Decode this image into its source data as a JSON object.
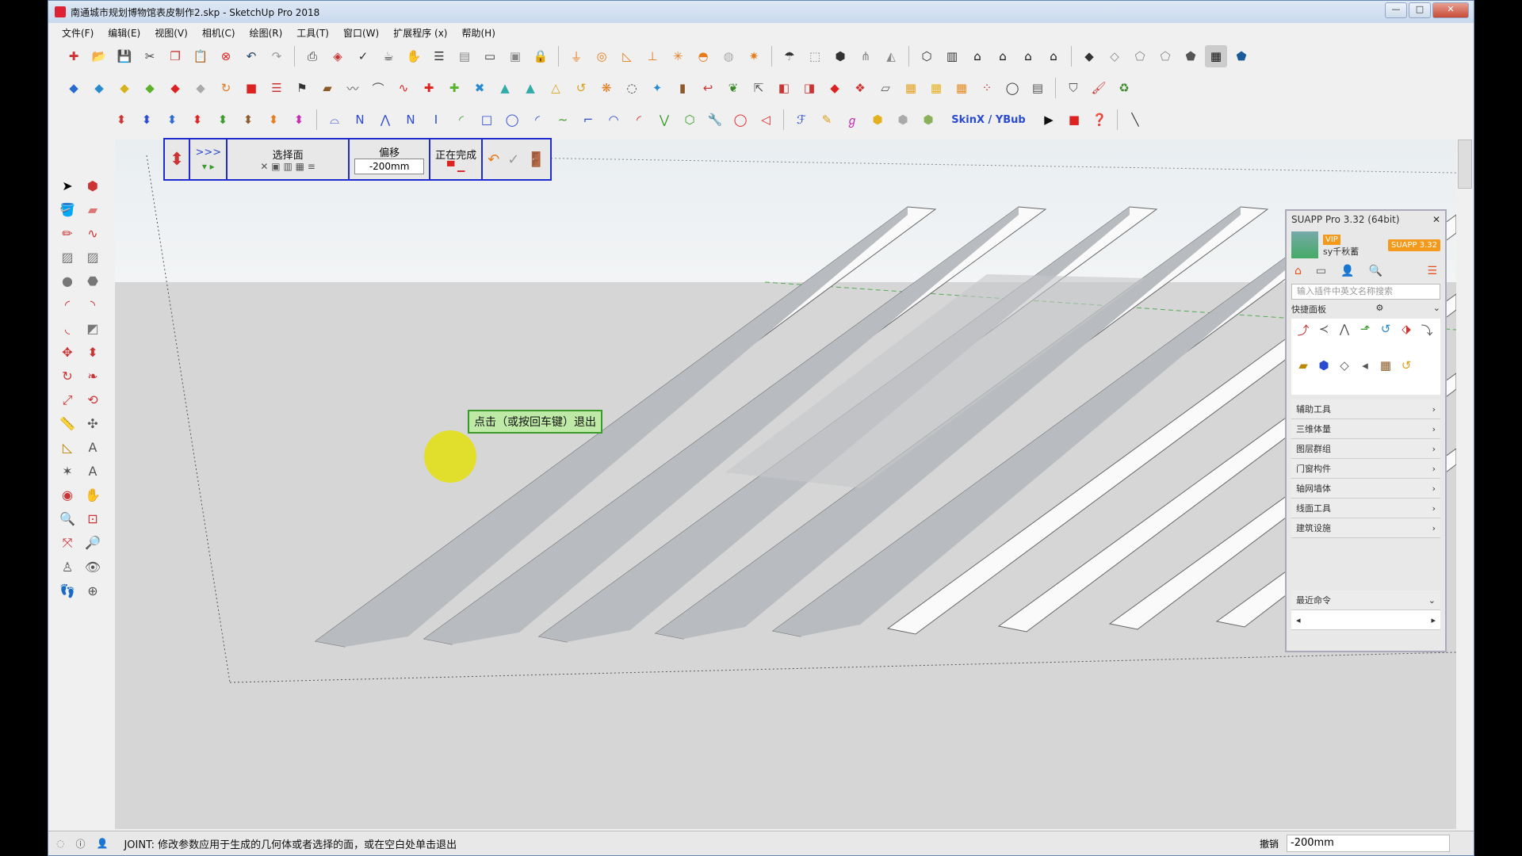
{
  "window": {
    "title": "南通城市规划博物馆表皮制作2.skp - SketchUp Pro 2018",
    "controls": {
      "minimize": "—",
      "maximize": "□",
      "close": "✕"
    }
  },
  "menu": [
    "文件(F)",
    "编辑(E)",
    "视图(V)",
    "相机(C)",
    "绘图(R)",
    "工具(T)",
    "窗口(W)",
    "扩展程序 (x)",
    "帮助(H)"
  ],
  "joint_toolbar": {
    "select_face_label": "选择面",
    "offset_label": "偏移",
    "offset_value": "-200mm",
    "completing_label": "正在完成",
    "nav_label": ">>>"
  },
  "tooltip": "点击（或按回车键）退出",
  "toolbar_extra": {
    "skinx_label": "SkinX / YBub"
  },
  "suapp": {
    "title": "SUAPP Pro 3.32 (64bit)",
    "username": "sy千秋蓄",
    "vip_badge": "VIP",
    "version_badge": "SUAPP 3.32",
    "search_placeholder": "输入插件中英文名称搜索",
    "quick_panel": "快捷面板",
    "categories": [
      "辅助工具",
      "三维体量",
      "图层群组",
      "门窗构件",
      "轴网墙体",
      "线面工具",
      "建筑设施"
    ],
    "recent": "最近命令"
  },
  "status": {
    "text": "JOINT: 修改参数应用于生成的几何体或者选择的面，或在空白处单击退出",
    "measure_label": "撤销",
    "measure_value": "-200mm"
  }
}
